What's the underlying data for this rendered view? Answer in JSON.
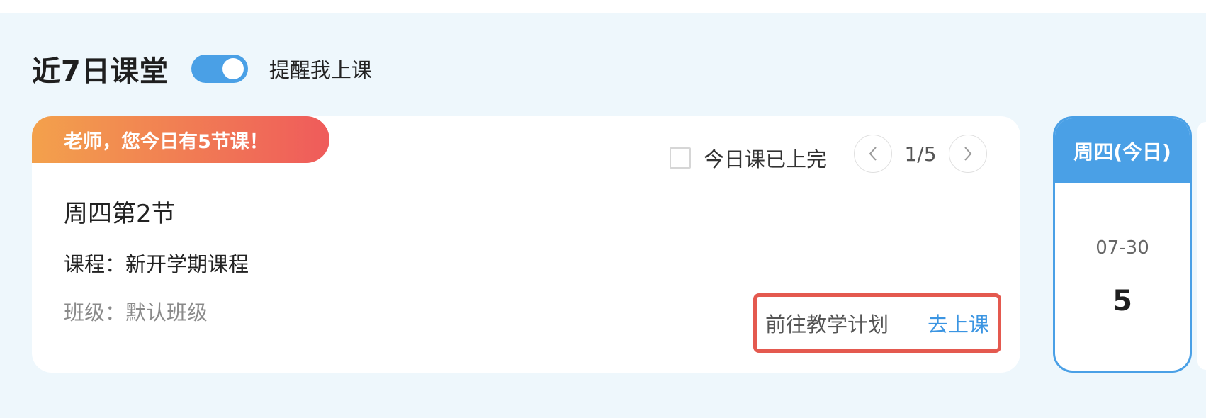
{
  "header": {
    "title": "近7日课堂",
    "reminder_label": "提醒我上课",
    "reminder_on": true
  },
  "today_card": {
    "banner": "老师，您今日有5节课！",
    "done_label": "今日课已上完",
    "done_checked": false,
    "pager": "1/5",
    "prev_icon": "chevron-left-icon",
    "next_icon": "chevron-right-icon",
    "lesson_title": "周四第2节",
    "course": "课程：新开学期课程",
    "class_name": "班级：默认班级",
    "plan_link": "前往教学计划",
    "go_link": "去上课"
  },
  "day_cards": [
    {
      "weekday": "周四(今日)",
      "date": "07-30",
      "count": "5"
    }
  ],
  "colors": {
    "accent": "#4aa0e6",
    "banner_start": "#f3a14c",
    "banner_end": "#ef5b5b",
    "highlight_border": "#e4594f",
    "link": "#3b95e2"
  }
}
